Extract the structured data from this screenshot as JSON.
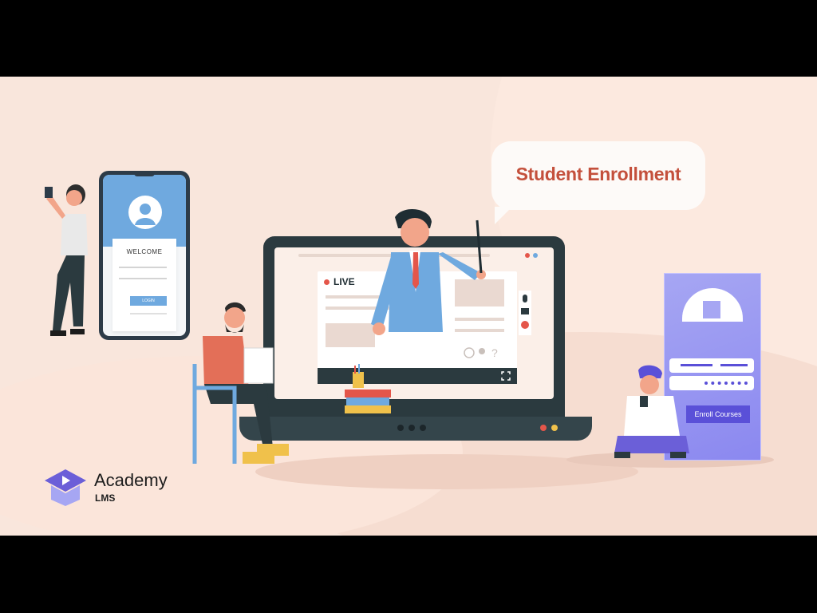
{
  "banner": {
    "bubble_title": "Student Enrollment",
    "phone": {
      "welcome": "WELCOME",
      "login": "LOGIN"
    },
    "screen": {
      "live": "LIVE"
    },
    "enroll_button": "Enroll Courses",
    "brand": {
      "name": "Academy",
      "product": "LMS"
    }
  },
  "colors": {
    "background": "#f9e6dc",
    "accent_orange": "#c4503c",
    "accent_purple": "#5a50d8",
    "accent_blue": "#6fa9df"
  },
  "icons": [
    "user-icon",
    "graduation-cap-icon",
    "pencil-cup-icon",
    "book-stack-icon",
    "fullscreen-icon",
    "globe-icon",
    "location-icon",
    "question-icon"
  ]
}
